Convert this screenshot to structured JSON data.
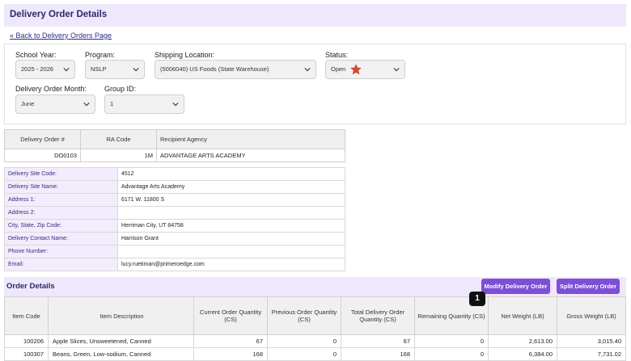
{
  "page": {
    "title": "Delivery Order Details",
    "back_link": "« Back to Delivery Orders Page"
  },
  "filters": {
    "school_year": {
      "label": "School Year:",
      "value": "2025 - 2026"
    },
    "program": {
      "label": "Program:",
      "value": "NSLP"
    },
    "shipping_location": {
      "label": "Shipping Location:",
      "value": "(5006040) US Foods (State Warehouse)"
    },
    "status": {
      "label": "Status:",
      "value": "Open"
    },
    "delivery_order_month": {
      "label": "Delivery Order Month:",
      "value": "June"
    },
    "group_id": {
      "label": "Group ID:",
      "value": "1"
    }
  },
  "ra_table": {
    "headers": [
      "Delivery Order #",
      "RA Code",
      "Recipient Agency"
    ],
    "row": [
      "DO0103",
      "1M",
      "ADVANTAGE ARTS ACADEMY"
    ]
  },
  "site_info": [
    {
      "label": "Delivery Site Code:",
      "value": "4512"
    },
    {
      "label": "Delivery Site Name:",
      "value": "Advantage Arts Academy"
    },
    {
      "label": "Address 1:",
      "value": "6171 W. 11800 S"
    },
    {
      "label": "Address 2:",
      "value": ""
    },
    {
      "label": "City, State, Zip Code:",
      "value": "Herriman City, UT 84758"
    },
    {
      "label": "Delivery Contact Name:",
      "value": "Harrison Grant"
    },
    {
      "label": "Phone Number:",
      "value": ""
    },
    {
      "label": "Email:",
      "value": "lucy.ruetiman@primeroedge.com"
    }
  ],
  "order": {
    "title": "Order Details",
    "modify_button": "Modify Delivery Order",
    "split_button": "Split Delivery Order",
    "badge": "1",
    "headers": [
      "Item Code",
      "Item Description",
      "Current Order Quantity (CS)",
      "Previous Order Quantity (CS)",
      "Total Delivery Order Quantity (CS)",
      "Remaining Quantity (CS)",
      "Net Weight (LB)",
      "Gross Weight (LB)"
    ],
    "rows": [
      [
        "100206",
        "Apple Slices, Unsweetened, Canned",
        "67",
        "0",
        "67",
        "0",
        "2,613.00",
        "3,015.40"
      ],
      [
        "100307",
        "Beans, Green, Low-sodium, Canned",
        "168",
        "0",
        "168",
        "0",
        "6,384.00",
        "7,731.02"
      ]
    ]
  },
  "colors": {
    "accent": "#7d4fd6",
    "header_band": "#efe7fb",
    "star": "#d9482f"
  }
}
